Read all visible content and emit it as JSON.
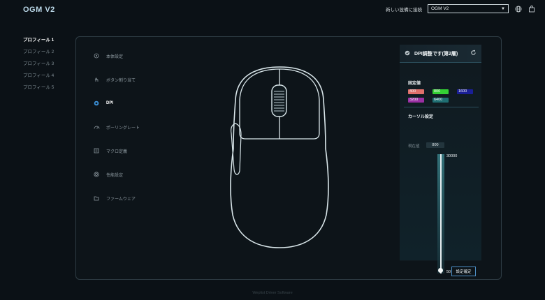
{
  "app": {
    "title": "OGM V2"
  },
  "header": {
    "connect_link": "新しい設備に接続",
    "device_selected": "OGM V2"
  },
  "profiles": [
    {
      "label": "プロフィール 1",
      "active": true
    },
    {
      "label": "プロフィール 2",
      "active": false
    },
    {
      "label": "プロフィール 3",
      "active": false
    },
    {
      "label": "プロフィール 4",
      "active": false
    },
    {
      "label": "プロフィール 5",
      "active": false
    }
  ],
  "menu": [
    {
      "label": "本体設定",
      "icon": "device-settings-icon",
      "active": false
    },
    {
      "label": "ボタン割り当て",
      "icon": "hand-pointer-icon",
      "active": false
    },
    {
      "label": "DPI",
      "icon": "dpi-icon",
      "active": true
    },
    {
      "label": "ポーリングレート",
      "icon": "speed-gauge-icon",
      "active": false
    },
    {
      "label": "マクロ定義",
      "icon": "macro-icon",
      "active": false
    },
    {
      "label": "性能設定",
      "icon": "performance-icon",
      "active": false
    },
    {
      "label": "ファームウェア",
      "icon": "firmware-icon",
      "active": false
    }
  ],
  "dpi_panel": {
    "title": "DPI調整です(第2層)",
    "preset_label": "固定値",
    "presets": [
      {
        "value": "400",
        "color": "#e0706b"
      },
      {
        "value": "800",
        "color": "#34d134"
      },
      {
        "value": "1600",
        "color": "#1a1f96"
      },
      {
        "value": "3200",
        "color": "#9a2fa3"
      },
      {
        "value": "6400",
        "color": "#1f6f73"
      }
    ],
    "cursor_label": "カーソル設定",
    "current_label": "現在値",
    "current_value": "800",
    "slider_max": "30000",
    "slider_min": "50",
    "slider_value": 50
  },
  "confirm_button": "設定確定",
  "footer": "Weplist Driver Software"
}
